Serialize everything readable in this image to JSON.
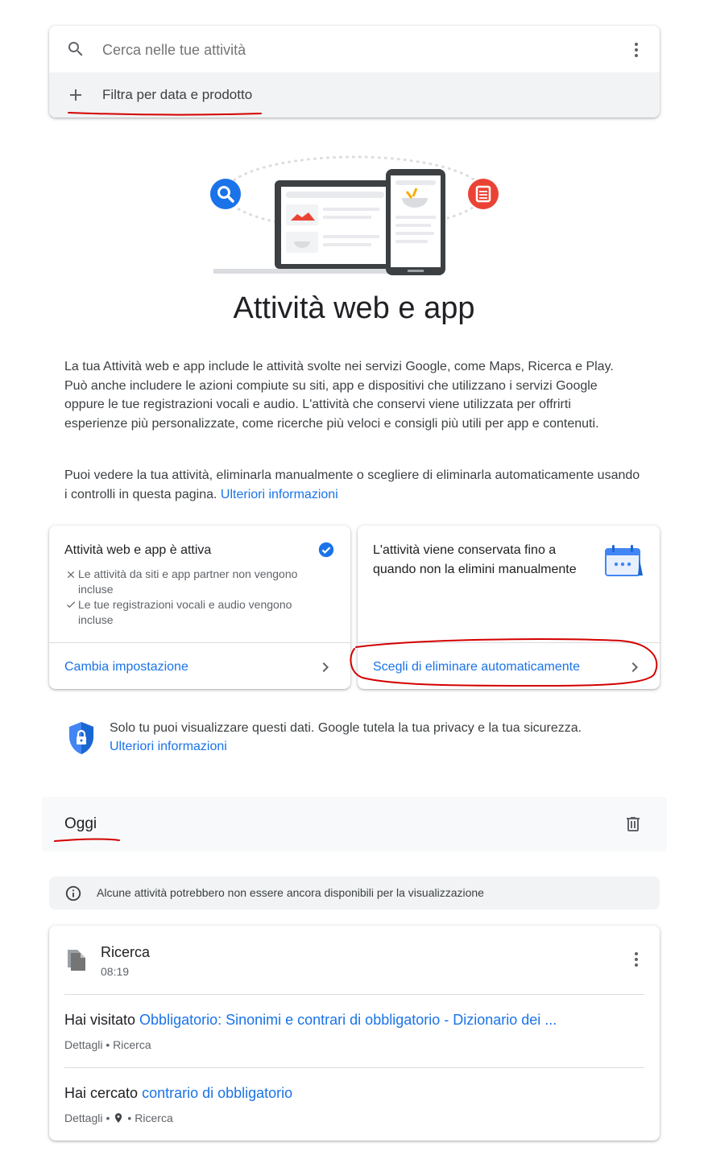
{
  "search": {
    "placeholder": "Cerca nelle tue attività",
    "filter_label": "Filtra per data e prodotto"
  },
  "hero": {
    "title": "Attività web e app"
  },
  "intro": {
    "paragraph1": "La tua Attività web e app include le attività svolte nei servizi Google, come Maps, Ricerca e Play. Può anche includere le azioni compiute su siti, app e dispositivi che utilizzano i servizi Google oppure le tue registrazioni vocali e audio. L'attività che conservi viene utilizzata per offrirti esperienze più personalizzate, come ricerche più veloci e consigli più utili per app e contenuti.",
    "paragraph2": "Puoi vedere la tua attività, eliminarla manualmente o scegliere di eliminarla automaticamente usando i controlli in questa pagina.",
    "learn_more": "Ulteriori informazioni"
  },
  "setting_card": {
    "title": "Attività web e app è attiva",
    "item1": "Le attività da siti e app partner non vengono incluse",
    "item2": "Le tue registrazioni vocali e audio vengono incluse",
    "action": "Cambia impostazione"
  },
  "retention_card": {
    "title": "L'attività viene conservata fino a quando non la elimini manualmente",
    "action": "Scegli di eliminare automaticamente"
  },
  "privacy": {
    "text": "Solo tu puoi visualizzare questi dati. Google tutela la tua privacy e la tua sicurezza.",
    "learn_more": "Ulteriori informazioni"
  },
  "day": {
    "label": "Oggi"
  },
  "notice": {
    "text": "Alcune attività potrebbero non essere ancora disponibili per la visualizzazione"
  },
  "activity": {
    "product": "Ricerca",
    "time": "08:19",
    "items": [
      {
        "verb": "Hai visitato",
        "link": "Obbligatorio: Sinonimi e contrari di obbligatorio - Dizionario dei ...",
        "details": "Dettagli",
        "source": "Ricerca"
      },
      {
        "verb": "Hai cercato",
        "link": "contrario di obbligatorio",
        "details": "Dettagli",
        "source": "Ricerca"
      }
    ]
  },
  "colors": {
    "accent": "#1a73e8",
    "text": "#202124",
    "secondary_text": "#5f6368",
    "annotation_red": "#d40000",
    "search_icon_blue": "#1a73e8",
    "doc_icon_red": "#ea4335"
  }
}
